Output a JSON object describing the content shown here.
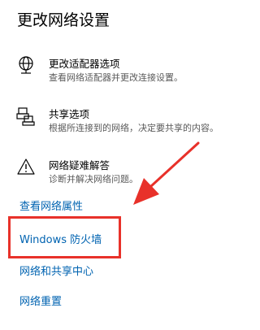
{
  "page": {
    "title": "更改网络设置"
  },
  "options": [
    {
      "icon": "network-adapter-icon",
      "label": "更改适配器选项",
      "description": "查看网络适配器并更改连接设置。"
    },
    {
      "icon": "sharing-options-icon",
      "label": "共享选项",
      "description": "根据所连接到的网络，决定要共享的内容。"
    },
    {
      "icon": "warning-troubleshoot-icon",
      "label": "网络疑难解答",
      "description": "诊断并解决网络问题。"
    }
  ],
  "links": {
    "view_properties": "查看网络属性",
    "windows_firewall": "Windows 防火墙",
    "network_sharing_center": "网络和共享中心",
    "network_reset": "网络重置"
  },
  "annotation": {
    "highlight_color": "#e8312a",
    "link_color": "#0063b1"
  }
}
